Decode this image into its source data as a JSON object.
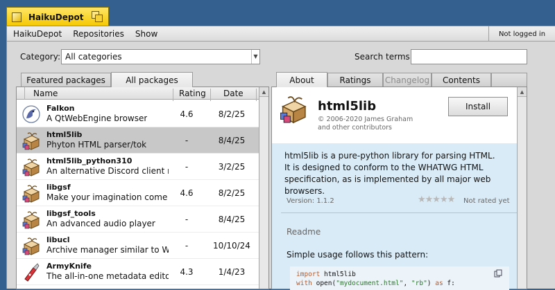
{
  "window": {
    "title": "HaikuDepot"
  },
  "menu": {
    "items": [
      "HaikuDepot",
      "Repositories",
      "Show"
    ],
    "login_status": "Not logged in"
  },
  "filters": {
    "category_label": "Category:",
    "category_value": "All categories",
    "search_label": "Search terms:",
    "search_value": ""
  },
  "left_tabs": [
    "Featured packages",
    "All packages"
  ],
  "right_tabs": [
    "About",
    "Ratings",
    "Changelog",
    "Contents"
  ],
  "columns": {
    "name": "Name",
    "rating": "Rating",
    "date": "Date"
  },
  "packages": [
    {
      "name": "Falkon",
      "desc": "A QtWebEngine browser",
      "rating": "4.6",
      "date": "8/2/25",
      "icon": "falkon-icon"
    },
    {
      "name": "html5lib",
      "desc": "Phyton HTML parser/tok",
      "rating": "-",
      "date": "8/4/25",
      "icon": "package-icon"
    },
    {
      "name": "html5lib_python310",
      "desc": "An alternative Discord client ma..",
      "rating": "-",
      "date": "3/2/25",
      "icon": "package-icon"
    },
    {
      "name": "libgsf",
      "desc": "Make your imagination come to...",
      "rating": "4.6",
      "date": "8/2/25",
      "icon": "package-icon"
    },
    {
      "name": "libgsf_tools",
      "desc": "An advanced audio player",
      "rating": "-",
      "date": "8/4/25",
      "icon": "package-icon"
    },
    {
      "name": "libucl",
      "desc": "Archive manager similar to WinZip",
      "rating": "-",
      "date": "10/10/24",
      "icon": "package-icon"
    },
    {
      "name": "ArmyKnife",
      "desc": "The all-in-one metadata editor f..",
      "rating": "4.3",
      "date": "1/4/23",
      "icon": "armyknife-icon"
    }
  ],
  "details": {
    "title": "html5lib",
    "copyright": "© 2006-2020 James Graham and other contributors",
    "install_label": "Install",
    "description": "html5lib is a pure-python library for parsing HTML. It is designed to conform to the WHATWG HTML specification, as is implemented by all major web browsers.",
    "version": "Version: 1.1.2",
    "rating_status": "Not rated yet",
    "readme_label": "Readme",
    "usage_text": "Simple usage follows this pattern:",
    "code": {
      "line1_kw": "import",
      "line1_rest": " html5lib",
      "line2_kw": "with",
      "line2_a": " open(",
      "line2_s1": "\"mydocument.html\"",
      "line2_b": ", ",
      "line2_s2": "\"rb\"",
      "line2_c": ") ",
      "line2_kw2": "as",
      "line2_d": " f:"
    }
  },
  "colors": {
    "desktop": "#33608f",
    "tab_yellow": "#f5c800",
    "detail_bg": "#d9ebf7",
    "selected_row": "#c8c8c8"
  }
}
